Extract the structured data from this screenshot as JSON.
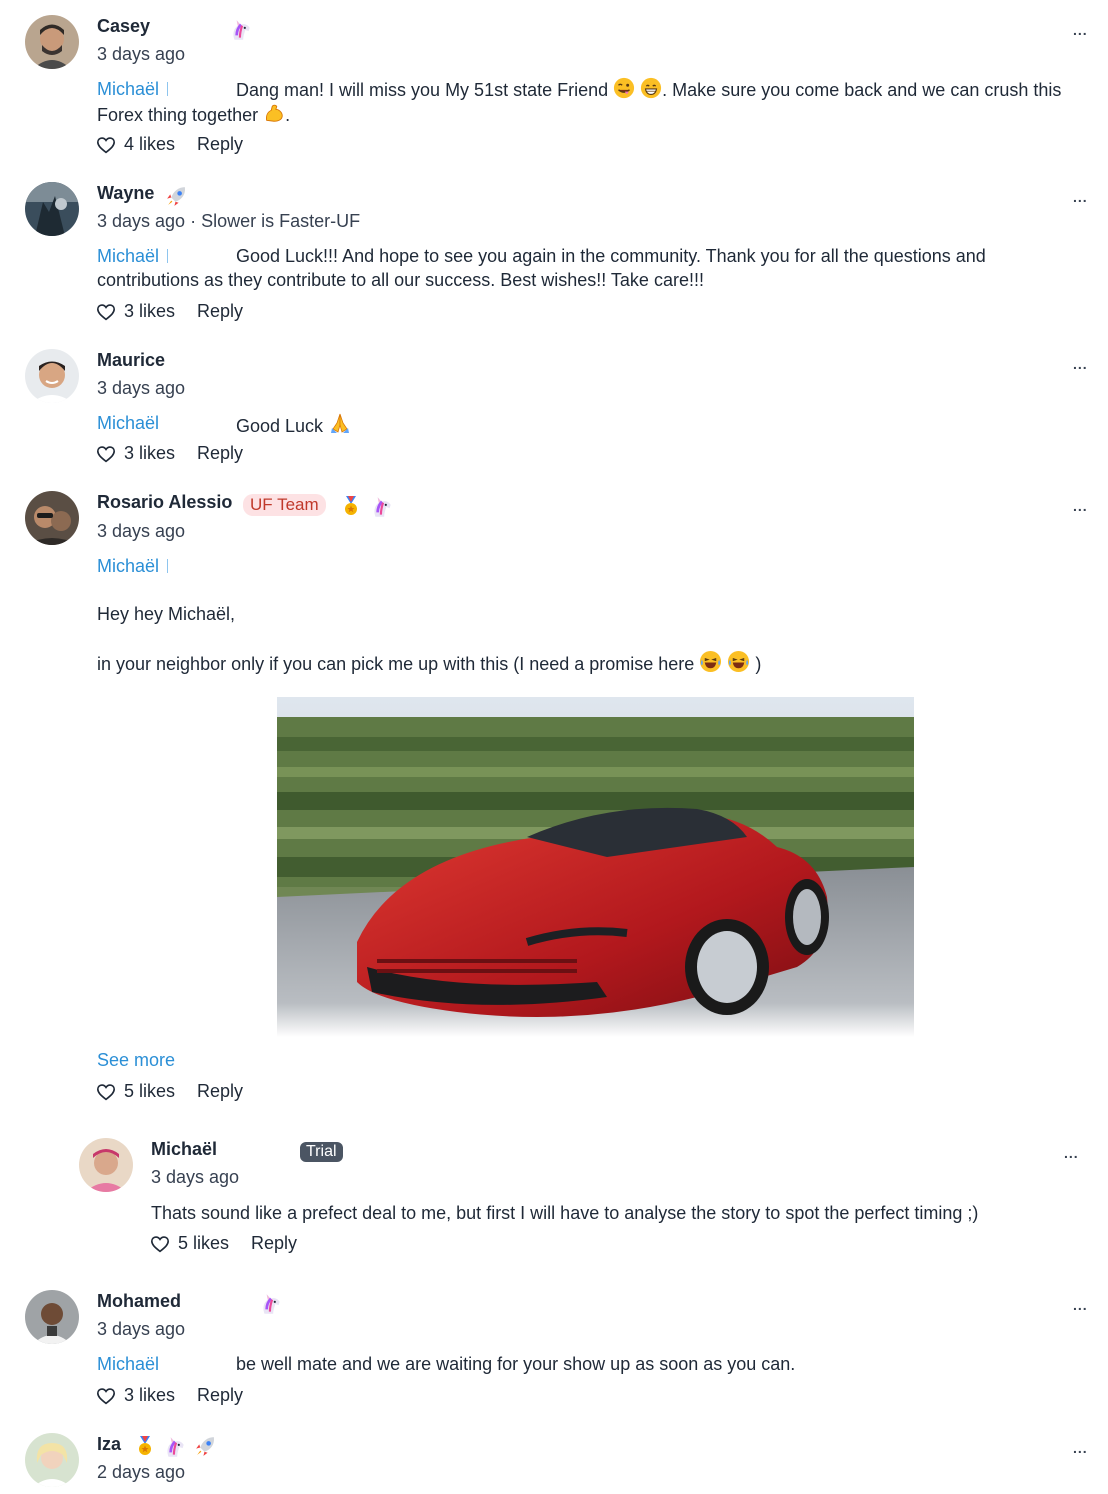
{
  "ui": {
    "more_label": "...",
    "reply_label": "Reply"
  },
  "comments": [
    {
      "author": "Casey",
      "time": "3 days ago",
      "mention": "Michaël",
      "badges": [
        "unicorn"
      ],
      "text": "Dang man! I will miss you My 51st state Friend 😜 😁. Make sure you come back and we can crush this Forex thing together 💪.",
      "likes": "4 likes"
    },
    {
      "author": "Wayne",
      "time": "3 days ago · Slower is Faster-UF",
      "mention": "Michaël",
      "badges": [
        "rocket"
      ],
      "text": "Good Luck!!! And hope to see you again in the community. Thank you for all the questions and contributions as they contribute to all our success. Best wishes!! Take care!!!",
      "likes": "3 likes"
    },
    {
      "author": "Maurice",
      "time": "3 days ago",
      "mention": "Michaël",
      "text": "Good Luck 🙏",
      "likes": "3 likes"
    },
    {
      "author": "Rosario Alessio",
      "team_badge": "UF Team",
      "badges": [
        "medal",
        "unicorn"
      ],
      "time": "3 days ago",
      "mention": "Michaël",
      "paragraph_1": "Hey hey Michaël,",
      "paragraph_2": "in your neighbor only if you can pick me up with this (I need a promise here 😂 😂 )",
      "image_alt": "red-sports-car-photo",
      "see_more": "See more",
      "likes": "5 likes",
      "reply": {
        "author": "Michaël",
        "badge": "Trial",
        "time": "3 days ago",
        "text": "Thats sound like a prefect deal to me, but first I will have to analyse the story to spot the perfect timing ;)",
        "likes": "5 likes"
      }
    },
    {
      "author": "Mohamed",
      "time": "3 days ago",
      "mention": "Michaël",
      "badges": [
        "unicorn"
      ],
      "text": "be well mate and we are waiting for your show up as soon as you can.",
      "likes": "3 likes"
    },
    {
      "author": "Iza",
      "time": "2 days ago",
      "badges": [
        "medal",
        "unicorn",
        "rocket"
      ]
    }
  ]
}
